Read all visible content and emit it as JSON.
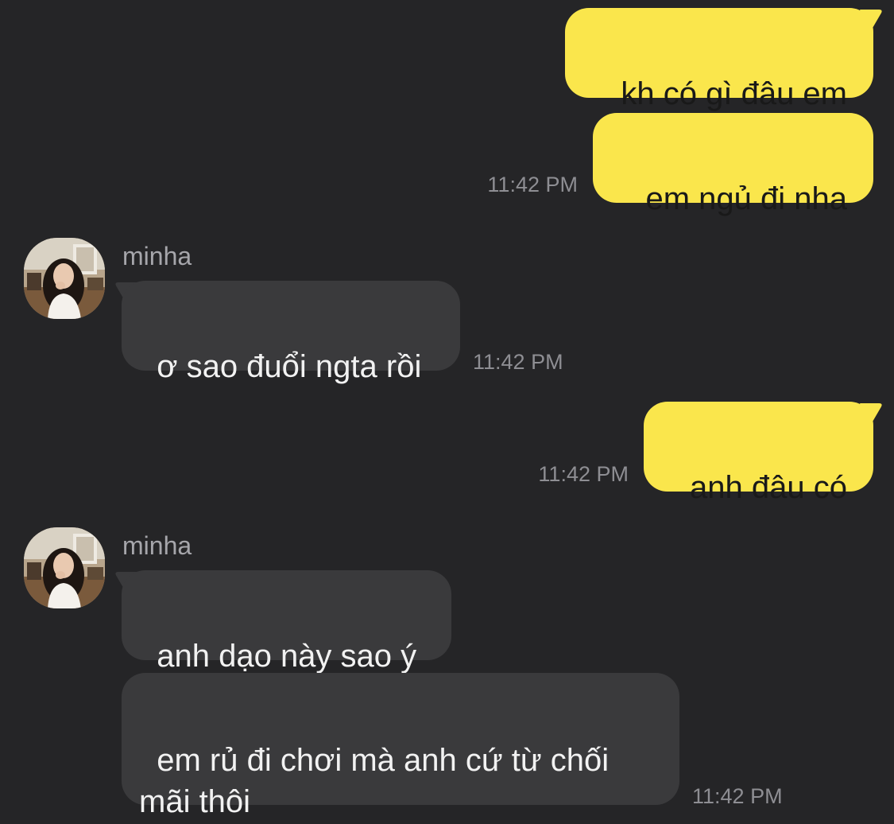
{
  "colors": {
    "background": "#252527",
    "outgoing_bubble": "#FAE64C",
    "incoming_bubble": "#3A3A3C",
    "timestamp": "#8E8E93"
  },
  "messages": [
    {
      "id": "m1",
      "direction": "outgoing",
      "text": "kh có gì đâu em"
    },
    {
      "id": "m2",
      "direction": "outgoing",
      "text": "em ngủ đi nha",
      "time": "11:42 PM"
    },
    {
      "id": "m3",
      "direction": "incoming",
      "sender": "minha",
      "text": "ơ sao đuổi ngta rồi",
      "time": "11:42 PM"
    },
    {
      "id": "m4",
      "direction": "outgoing",
      "text": "anh đâu có",
      "time": "11:42 PM"
    },
    {
      "id": "m5",
      "direction": "incoming",
      "sender": "minha",
      "text": "anh dạo này sao ý"
    },
    {
      "id": "m6",
      "direction": "incoming",
      "text": "em rủ đi chơi mà anh cứ từ chối\nmãi thôi",
      "time": "11:42 PM"
    }
  ],
  "avatar_icon": "profile-photo"
}
